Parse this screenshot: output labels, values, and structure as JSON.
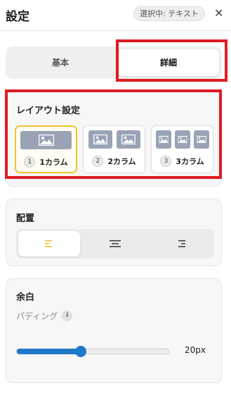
{
  "header": {
    "title": "設定",
    "selection_badge": "選択中: テキスト",
    "close_icon": "close-icon"
  },
  "tabs": [
    {
      "label": "基本",
      "active": false
    },
    {
      "label": "詳細",
      "active": true
    }
  ],
  "layout_section": {
    "title": "レイアウト設定",
    "options": [
      {
        "number": "1",
        "label": "1カラム",
        "selected": true
      },
      {
        "number": "2",
        "label": "2カラム",
        "selected": false
      },
      {
        "number": "3",
        "label": "3カラム",
        "selected": false
      }
    ]
  },
  "align_section": {
    "title": "配置",
    "options": [
      {
        "icon": "align-left-icon",
        "active": true
      },
      {
        "icon": "align-center-icon",
        "active": false
      },
      {
        "icon": "align-right-icon",
        "active": false
      }
    ]
  },
  "spacing_section": {
    "title": "余白",
    "padding_label": "パディング",
    "info_icon_text": "i",
    "padding_value": "20px",
    "padding_fraction": 0.42
  },
  "colors": {
    "highlight": "#e01b22",
    "selected_border": "#f2c230",
    "accent": "#1f78c8",
    "active_align_icon": "#f2c230"
  }
}
